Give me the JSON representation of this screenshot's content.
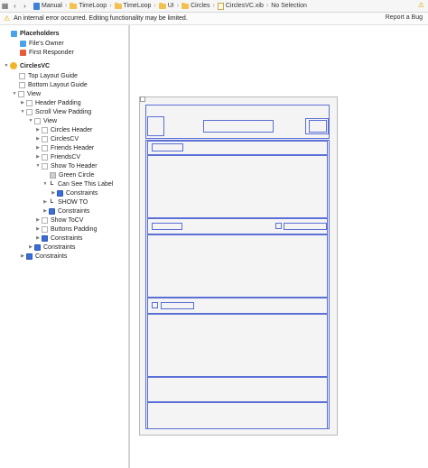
{
  "breadcrumb": {
    "items": [
      "Manual",
      "TimeLoop",
      "TimeLoop",
      "UI",
      "Circles",
      "CirclesVC.xib",
      "No Selection"
    ]
  },
  "error_bar": {
    "message": "An internal error occurred. Editing functionality may be limited.",
    "report_label": "Report a Bug"
  },
  "outline": {
    "placeholders_header": "Placeholders",
    "files_owner": "File's Owner",
    "first_responder": "First Responder",
    "root": "CirclesVC",
    "top_layout_guide": "Top Layout Guide",
    "bottom_layout_guide": "Bottom Layout Guide",
    "view": "View",
    "header_padding": "Header Padding",
    "scroll_view_padding": "Scroll View Padding",
    "inner_view": "View",
    "circles_header": "Circles Header",
    "circles_cv": "CirclesCV",
    "friends_header": "Friends Header",
    "friends_cv": "FriendsCV",
    "show_to_header": "Show To Header",
    "green_circle": "Green Circle",
    "can_see_label": "Can See This Label",
    "constraints_1": "Constraints",
    "show_to": "SHOW TO",
    "constraints_2": "Constraints",
    "show_to_cv": "Show ToCV",
    "buttons_padding": "Buttons Padding",
    "constraints_3": "Constraints",
    "constraints_4": "Constraints",
    "constraints_5": "Constraints"
  },
  "colors": {
    "constraint_blue": "#3a6fd8",
    "frame_outline": "#5b6fd6",
    "folder_yellow": "#f2c250",
    "warning": "#e0a800"
  }
}
